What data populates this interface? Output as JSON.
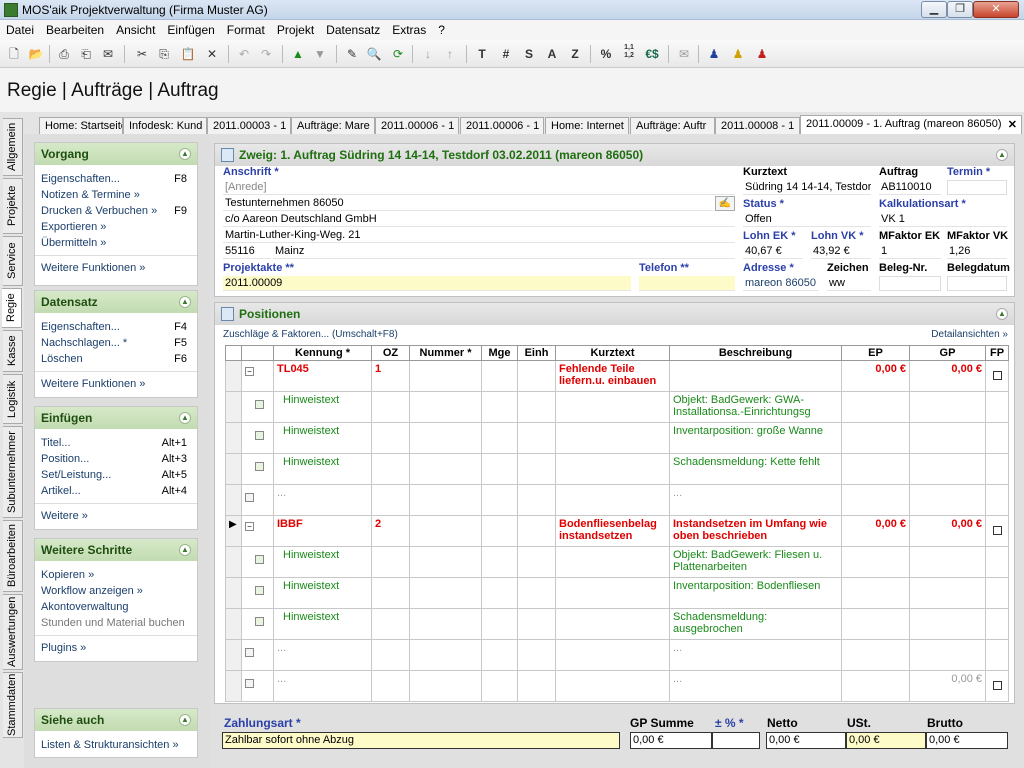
{
  "window": {
    "title": "MOS'aik Projektverwaltung (Firma Muster AG)"
  },
  "menu": [
    "Datei",
    "Bearbeiten",
    "Ansicht",
    "Einfügen",
    "Format",
    "Projekt",
    "Datensatz",
    "Extras",
    "?"
  ],
  "toolbar": {
    "text_buttons": [
      "T",
      "#",
      "S",
      "A",
      "Z",
      "%",
      "1,1\n1,2",
      "€$"
    ]
  },
  "heading": "Regie | Aufträge | Auftrag",
  "vtabs": [
    "Allgemein",
    "Projekte",
    "Service",
    "Regie",
    "Kasse",
    "Logistik",
    "Subunternehmer",
    "Büroarbeiten",
    "Auswertungen",
    "Stammdaten"
  ],
  "doctabs": [
    "Home: Startseite",
    "Infodesk: Kund",
    "2011.00003 - 1",
    "Aufträge: Mare",
    "2011.00006 - 1",
    "2011.00006 - 1",
    "Home: Internet",
    "Aufträge: Auftr",
    "2011.00008 - 1",
    "2011.00009 - 1. Auftrag (mareon 86050)"
  ],
  "left": {
    "vorgang": {
      "title": "Vorgang",
      "items": [
        {
          "label": "Eigenschaften...",
          "key": "F8"
        },
        {
          "label": "Notizen & Termine »",
          "key": ""
        },
        {
          "label": "Drucken & Verbuchen »",
          "key": "F9"
        },
        {
          "label": "Exportieren »",
          "key": ""
        },
        {
          "label": "Übermitteln »",
          "key": ""
        }
      ],
      "more": "Weitere Funktionen »"
    },
    "datensatz": {
      "title": "Datensatz",
      "items": [
        {
          "label": "Eigenschaften...",
          "key": "F4"
        },
        {
          "label": "Nachschlagen... *",
          "key": "F5"
        },
        {
          "label": "Löschen",
          "key": "F6"
        }
      ],
      "more": "Weitere Funktionen »"
    },
    "einfuegen": {
      "title": "Einfügen",
      "items": [
        {
          "label": "Titel...",
          "key": "Alt+1"
        },
        {
          "label": "Position...",
          "key": "Alt+3"
        },
        {
          "label": "Set/Leistung...",
          "key": "Alt+5"
        },
        {
          "label": "Artikel...",
          "key": "Alt+4"
        }
      ],
      "more": "Weitere »"
    },
    "schritte": {
      "title": "Weitere Schritte",
      "items": [
        {
          "label": "Kopieren »"
        },
        {
          "label": "Workflow anzeigen »"
        },
        {
          "label": "Akontoverwaltung"
        },
        {
          "label": "Stunden und Material buchen"
        }
      ],
      "plugins": "Plugins »"
    },
    "siehe": {
      "title": "Siehe auch",
      "item": "Listen & Strukturansichten »"
    }
  },
  "header_panel": {
    "title": "Zweig: 1. Auftrag Südring 14 14-14, Testdorf 03.02.2011 (mareon 86050)",
    "anschrift_label": "Anschrift *",
    "anrede": "[Anrede]",
    "address_lines": [
      "Testunternehmen 86050",
      "c/o Aareon Deutschland GmbH",
      "Martin-Luther-King-Weg. 21"
    ],
    "plz": "55116",
    "ort": "Mainz",
    "projektakte_label": "Projektakte **",
    "projektakte": "2011.00009",
    "telefon_label": "Telefon **",
    "telefon": "",
    "kurztext_label": "Kurztext",
    "kurztext": "Südring 14 14-14, Testdor",
    "auftrag_label": "Auftrag",
    "auftrag": "AB110010",
    "termin_label": "Termin *",
    "termin": "",
    "status_label": "Status *",
    "status": "Offen",
    "kalk_label": "Kalkulationsart *",
    "kalk": "VK 1",
    "lohnek_label": "Lohn EK *",
    "lohnek": "40,67 €",
    "lohnvk_label": "Lohn VK *",
    "lohnvk": "43,92 €",
    "mfek_label": "MFaktor EK",
    "mfek": "1",
    "mfvk_label": "MFaktor VK",
    "mfvk": "1,26",
    "adresse_label": "Adresse *",
    "adresse": "mareon 86050",
    "zeichen_label": "Zeichen",
    "zeichen": "ww",
    "belegnr_label": "Beleg-Nr.",
    "belegnr": "",
    "belegdatum_label": "Belegdatum",
    "belegdatum": ""
  },
  "positions": {
    "title": "Positionen",
    "zuschlaege": "Zuschläge & Faktoren... (Umschalt+F8)",
    "details": "Detailansichten »",
    "columns": [
      "Kennung *",
      "OZ",
      "Nummer *",
      "Mge",
      "Einh",
      "Kurztext",
      "Beschreibung",
      "EP",
      "GP",
      "FP"
    ],
    "rows": [
      {
        "kind": "pos",
        "kennung": "TL045",
        "oz": "1",
        "kurztext": "Fehlende Teile liefern.u. einbauen",
        "beschreibung": "",
        "ep": "0,00 €",
        "gp": "0,00 €"
      },
      {
        "kind": "hint",
        "kennung": "Hinweistext",
        "beschreibung": "Objekt: BadGewerk: GWA-Installationsa.-Einrichtungsg"
      },
      {
        "kind": "hint",
        "kennung": "Hinweistext",
        "beschreibung": "Inventarposition: große Wanne"
      },
      {
        "kind": "hint",
        "kennung": "Hinweistext",
        "beschreibung": "Schadensmeldung: Kette fehlt"
      },
      {
        "kind": "dots",
        "kennung": "...",
        "beschreibung": "..."
      },
      {
        "kind": "pos",
        "kennung": "IBBF",
        "oz": "2",
        "kurztext": "Bodenfliesenbelag instandsetzen",
        "beschreibung": "Instandsetzen im Umfang wie oben beschrieben",
        "ep": "0,00 €",
        "gp": "0,00 €"
      },
      {
        "kind": "hint",
        "kennung": "Hinweistext",
        "beschreibung": "Objekt: BadGewerk: Fliesen u. Plattenarbeiten"
      },
      {
        "kind": "hint",
        "kennung": "Hinweistext",
        "beschreibung": "Inventarposition: Bodenfliesen"
      },
      {
        "kind": "hint",
        "kennung": "Hinweistext",
        "beschreibung": "Schadensmeldung: ausgebrochen"
      },
      {
        "kind": "dots",
        "kennung": "...",
        "beschreibung": "..."
      },
      {
        "kind": "dots",
        "kennung": "...",
        "beschreibung": "...",
        "gp": "0,00 €"
      }
    ]
  },
  "footer": {
    "zahlungsart_label": "Zahlungsart *",
    "zahlungsart": "Zahlbar sofort ohne Abzug",
    "gpsumme_label": "GP Summe",
    "gpsumme": "0,00 €",
    "pct_label": "± % *",
    "pct": "",
    "netto_label": "Netto",
    "netto": "0,00 €",
    "ust_label": "USt.",
    "ust": "0,00 €",
    "brutto_label": "Brutto",
    "brutto": "0,00 €"
  }
}
